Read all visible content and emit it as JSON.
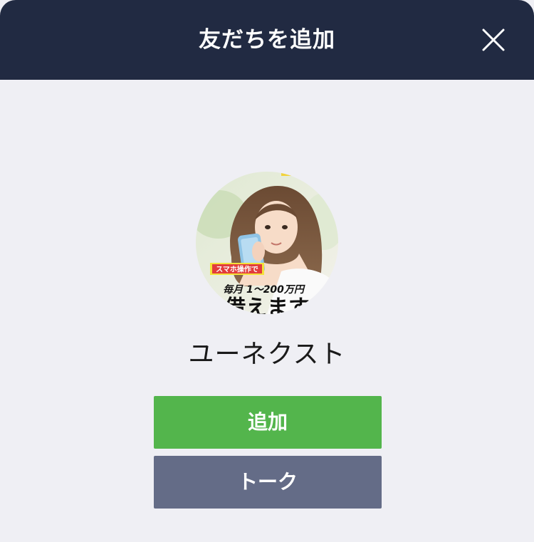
{
  "header": {
    "title": "友だちを追加"
  },
  "profile": {
    "name": "ユーネクスト",
    "avatar": {
      "banner_text": "スマホ操作で",
      "amount_text": "毎月 1～200万円",
      "bottom_text": "借えます"
    }
  },
  "actions": {
    "add_label": "追加",
    "talk_label": "トーク"
  },
  "colors": {
    "header_bg": "#212a42",
    "page_bg": "#efeff4",
    "add_button": "#53b54c",
    "talk_button": "#646c87"
  }
}
